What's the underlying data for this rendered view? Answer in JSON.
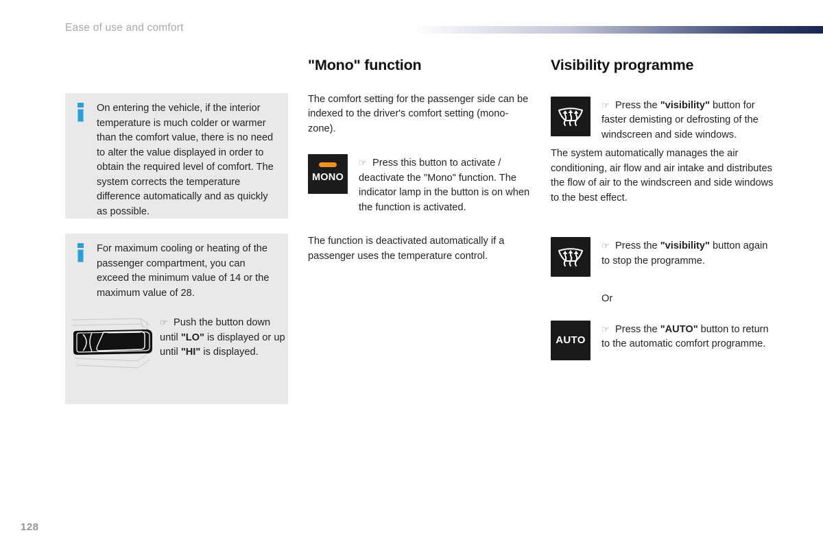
{
  "header": {
    "running_title": "Ease of use and comfort",
    "rule_gradient_from": "#ffffff",
    "rule_gradient_to": "#1a274f"
  },
  "colors": {
    "info_box_background": "#e9e9e9",
    "info_icon_blue": "#2f9ed6",
    "button_black": "#1a1a1a",
    "mono_lamp_orange": "#f0931c",
    "header_title_grey": "#a8a8ad",
    "folio_grey": "#939397",
    "body_text": "#242424"
  },
  "left_column": {
    "info_box_1": {
      "icon": "info-icon",
      "text": "On entering the vehicle, if the interior temperature is much colder or warmer than the comfort value, there is no need to alter the value displayed in order to obtain the required level of comfort. The system corrects the temperature difference automatically and as quickly as possible."
    },
    "info_box_2": {
      "icon": "info-icon",
      "text": "For maximum cooling or heating of the passenger compartment, you can exceed the minimum value of 14 or the maximum value of 28.",
      "figure": {
        "name": "rocker-switch-illustration",
        "description": "temperature rocker switch on dashboard"
      },
      "instruction": {
        "pointer_icon": "pointing-hand-icon",
        "part1": "Push the button down until ",
        "bold1": "\"LO\"",
        "part2": " is displayed or up until ",
        "bold2": "\"HI\"",
        "part3": " is displayed."
      }
    }
  },
  "middle_column": {
    "heading": "\"Mono\" function",
    "intro": "The comfort setting for the passenger side can be indexed to the driver's comfort setting (mono-zone).",
    "mono_button": {
      "icon": "mono-button-icon",
      "label": "MONO",
      "lamp": "indicator-lamp"
    },
    "mono_instruction": {
      "pointer_icon": "pointing-hand-icon",
      "text": "Press this button to activate / deactivate the \"Mono\" function. The indicator lamp in the button is on when the function is activated."
    },
    "closing": "The function is deactivated automatically if a passenger uses the temperature control."
  },
  "right_column": {
    "heading": "Visibility programme",
    "item_1": {
      "icon": "windscreen-demist-icon",
      "pointer_icon": "pointing-hand-icon",
      "part1": "Press the ",
      "bold1": "\"visibility\"",
      "part2": " button for faster demisting or defrosting of the windscreen and side windows."
    },
    "paragraph": "The system automatically manages the air conditioning, air flow and air intake and distributes the flow of air to the windscreen and side windows to the best effect.",
    "item_2": {
      "icon": "windscreen-demist-icon",
      "pointer_icon": "pointing-hand-icon",
      "part1": "Press the ",
      "bold1": "\"visibility\"",
      "part2": " button again to stop the programme."
    },
    "or_label": "Or",
    "item_3": {
      "icon": "auto-button-icon",
      "label": "AUTO",
      "pointer_icon": "pointing-hand-icon",
      "part1": "Press the ",
      "bold1": "\"AUTO\"",
      "part2": " button to return to the automatic comfort programme."
    }
  },
  "footer": {
    "page_number": "128"
  }
}
